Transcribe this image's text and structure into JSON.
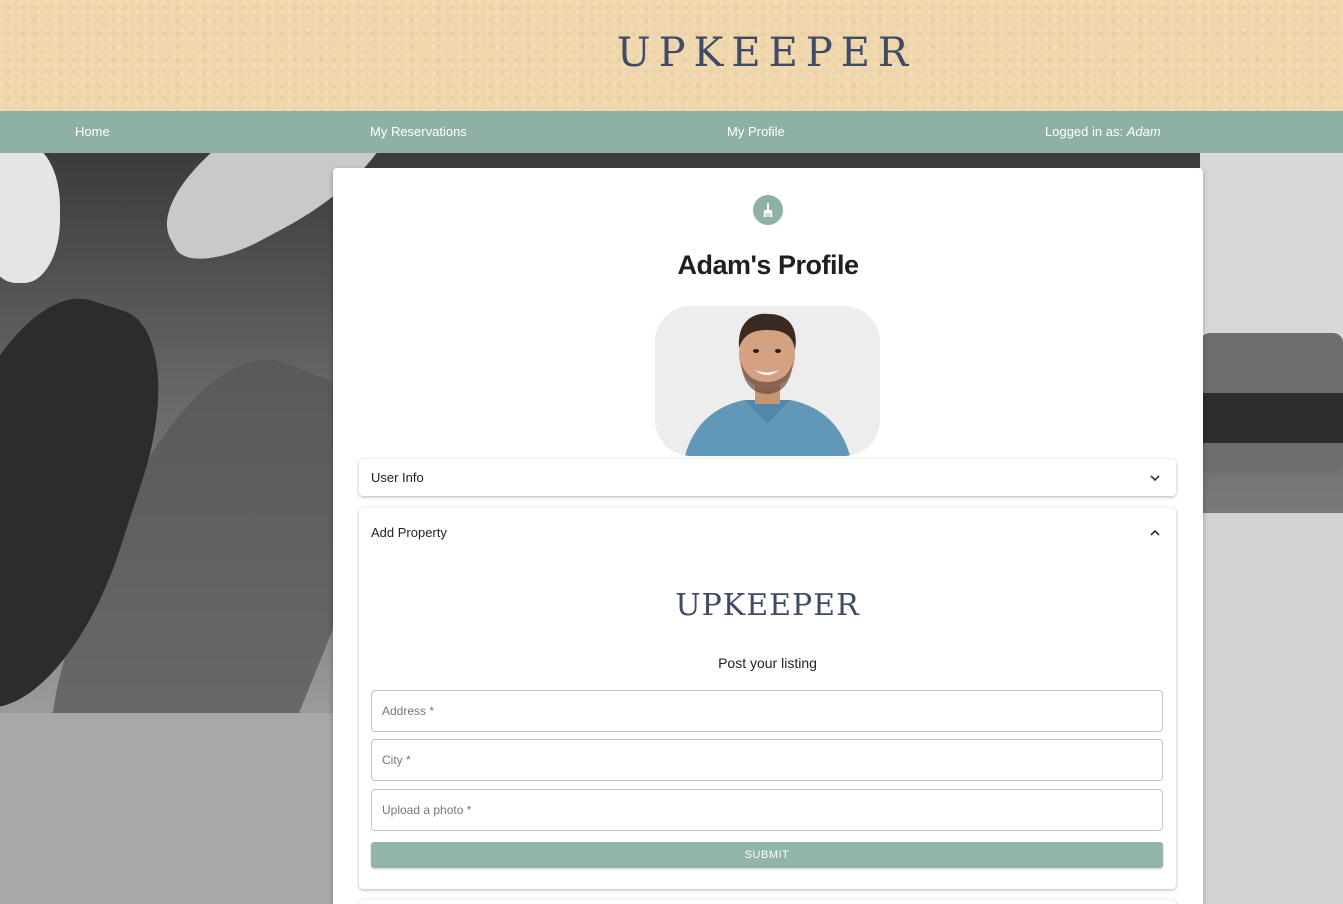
{
  "brand": {
    "logo_text": "UPKEEPER"
  },
  "nav": {
    "home": "Home",
    "reservations": "My Reservations",
    "profile": "My Profile",
    "logged_in_prefix": "Logged in as:",
    "logged_in_user": "Adam"
  },
  "profile": {
    "title": "Adam's Profile"
  },
  "accordions": {
    "user_info": {
      "label": "User Info",
      "expanded": false
    },
    "add_property": {
      "label": "Add Property",
      "expanded": true
    }
  },
  "add_property_form": {
    "logo_text": "UPKEEPER",
    "subtitle": "Post your listing",
    "address_placeholder": "Address *",
    "city_placeholder": "City *",
    "photo_placeholder": "Upload a photo *",
    "submit_label": "SUBMIT"
  },
  "colors": {
    "header_bg": "#f0d6ab",
    "nav_bg": "#8fb1a4",
    "logo": "#3e4a66",
    "submit_bg": "#93b5a8"
  },
  "icons": {
    "avatar_badge": "broom-icon",
    "accordion_collapsed": "chevron-down-icon",
    "accordion_expanded": "chevron-up-icon"
  }
}
